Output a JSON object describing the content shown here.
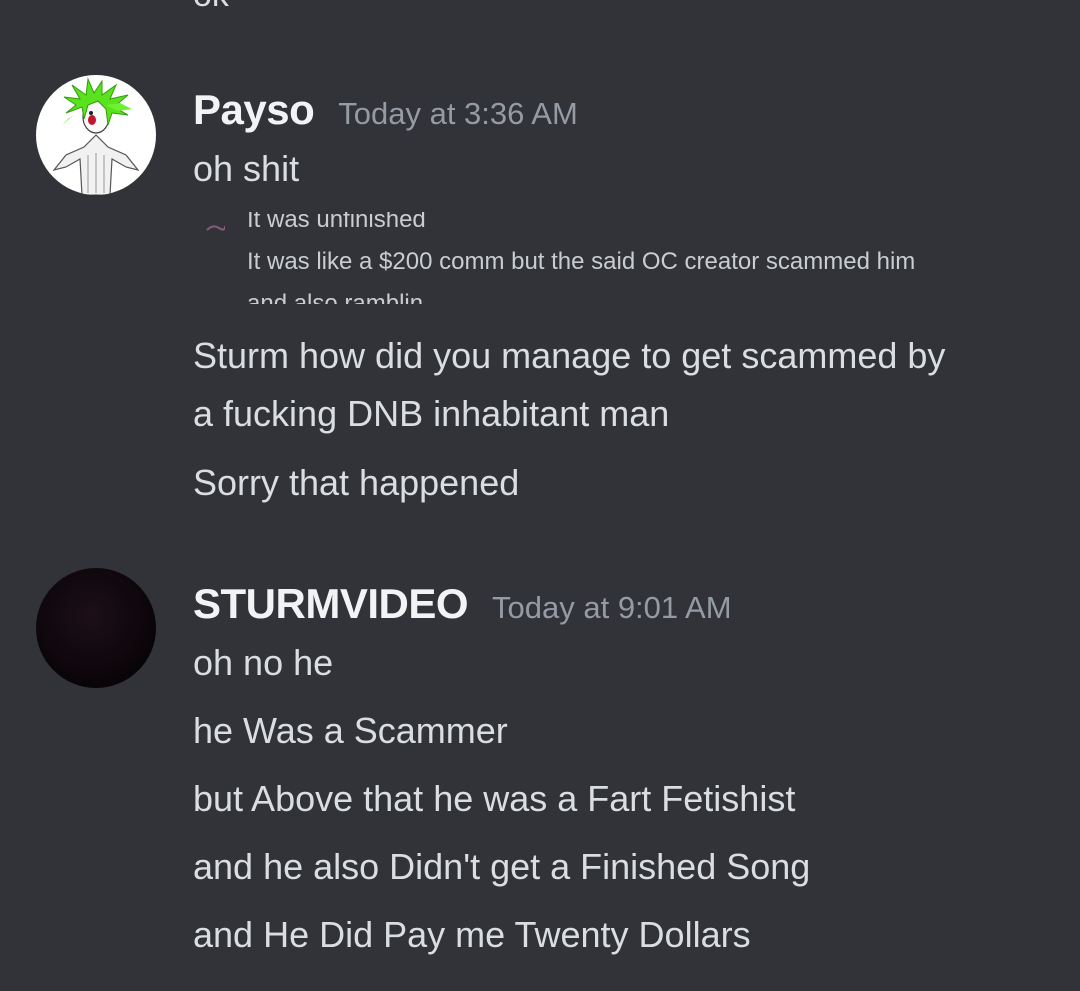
{
  "top_fragment": "ok",
  "messages": [
    {
      "username": "Payso",
      "timestamp": "Today at 3:36 AM",
      "avatar": "green-haired-character-avatar",
      "lines": [
        "oh shit"
      ],
      "embedded_image": {
        "line_cut_top": "It was unfinished",
        "line_main": "It was like a $200 comm but the said OC creator scammed him",
        "line_cut_bottom": "and also ramblin"
      },
      "after_lines": [
        "Sturm how did you manage to get scammed by",
        "a fucking DNB inhabitant man",
        "Sorry that happened"
      ]
    },
    {
      "username": "STURMVIDEO",
      "timestamp": "Today at 9:01 AM",
      "avatar": "dark-avatar",
      "lines": [
        "oh no he",
        "he Was a Scammer",
        "but Above that he was a Fart Fetishist",
        "and he also Didn't get a Finished Song",
        "and He Did Pay me Twenty Dollars"
      ]
    }
  ]
}
